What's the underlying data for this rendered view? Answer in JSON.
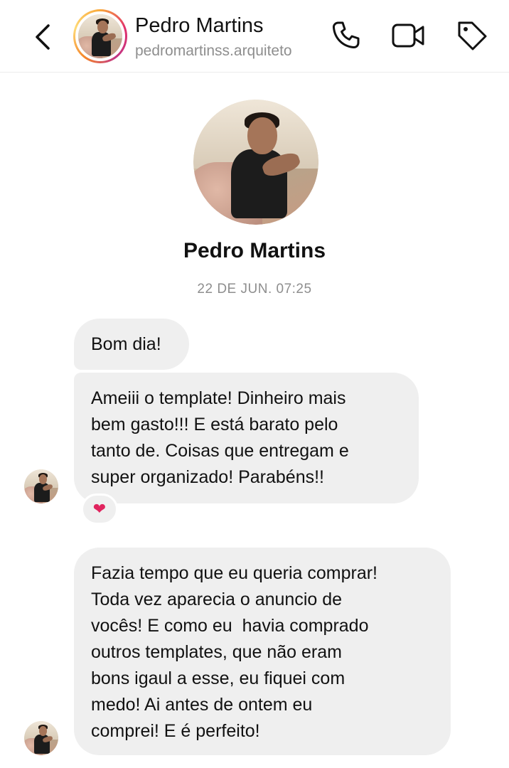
{
  "header": {
    "name": "Pedro Martins",
    "username": "pedromartinss.arquiteto",
    "icons": [
      "back-arrow-icon",
      "phone-icon",
      "video-camera-icon",
      "tag-icon"
    ]
  },
  "profile": {
    "name": "Pedro Martins",
    "timestamp": "22 DE JUN. 07:25"
  },
  "messages": [
    {
      "lines": [
        "Bom dia!"
      ]
    },
    {
      "lines": [
        "Ameiii o template! Dinheiro mais",
        "bem gasto!!! E está barato pelo",
        "tanto de. Coisas que entregam e",
        "super organizado! Parabéns!!"
      ],
      "reaction": "❤"
    },
    {
      "lines": [
        "Fazia tempo que eu queria comprar!",
        "Toda vez aparecia o anuncio de",
        "vocês! E como eu  havia comprado",
        "outros templates, que não eram",
        "bons igaul a esse, eu fiquei com",
        "medo! Ai antes de ontem eu",
        "comprei! E é perfeito!"
      ]
    }
  ],
  "colors": {
    "bubble": "#efefef",
    "secondary_text": "#8e8e8e",
    "reaction_heart": "#e0245e"
  }
}
